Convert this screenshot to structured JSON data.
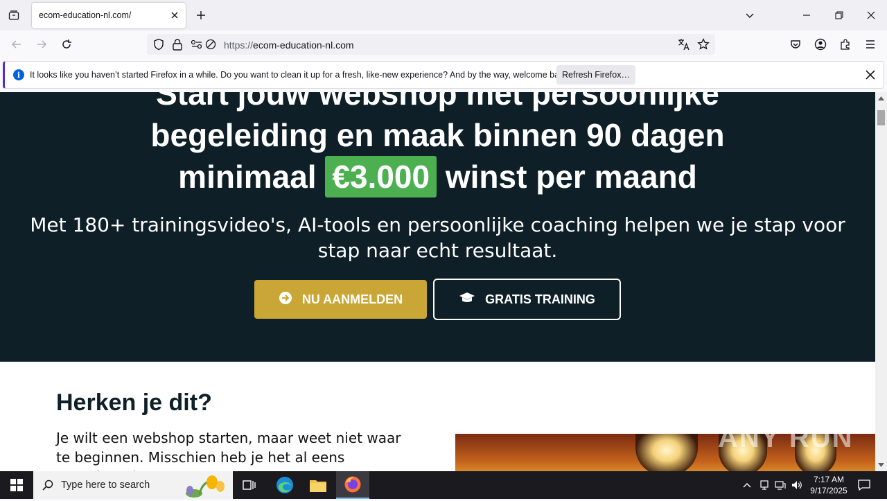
{
  "browser": {
    "tab_title": "ecom-education-nl.com/",
    "url_protocol": "https://",
    "url_domain": "ecom-education-nl.com",
    "notification": {
      "message": "It looks like you haven’t started Firefox in a while. Do you want to clean it up for a fresh, like-new experience? And by the way, welcome back!",
      "button_label": "Refresh Firefox…"
    }
  },
  "hero": {
    "line1": "Start jouw webshop met persoonlijke",
    "line2": "begeleiding en maak binnen 90 dagen",
    "line3_before": "minimaal",
    "line3_highlight": "€3.000",
    "line3_after": "winst per maand",
    "subtitle_line1": "Met 180+ trainingsvideo's, AI-tools en persoonlijke coaching helpen we je stap voor",
    "subtitle_line2": "stap naar echt resultaat.",
    "cta_primary": "NU AANMELDEN",
    "cta_secondary": "GRATIS TRAINING",
    "colors": {
      "background": "#0f1f27",
      "highlight": "#4caf50",
      "primary_button": "#c9a635"
    }
  },
  "section": {
    "heading": "Herken je dit?",
    "paragraph": "Je wilt een webshop starten, maar weet niet waar te beginnen. Misschien heb je het al eens geprobeerd,"
  },
  "watermark": "ANY RUN",
  "taskbar": {
    "search_placeholder": "Type here to search",
    "time": "7:17 AM",
    "date": "9/17/2025"
  }
}
